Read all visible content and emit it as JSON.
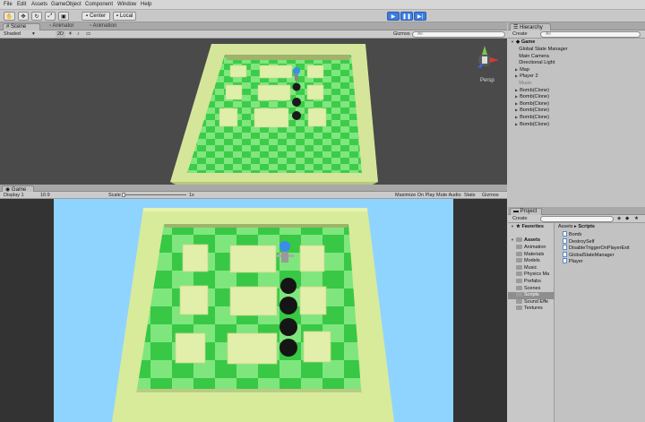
{
  "menu": [
    "File",
    "Edit",
    "Assets",
    "GameObject",
    "Component",
    "Window",
    "Help"
  ],
  "toolbar": {
    "center_label": "Center",
    "local_label": "Local"
  },
  "scene_panel": {
    "tabs": [
      "Scene",
      "Animator",
      "Animation"
    ],
    "shaded_label": "Shaded",
    "mode_2d": "2D",
    "gizmos_label": "Gizmos",
    "search_placeholder": "All",
    "persp_label": "Persp"
  },
  "game_panel": {
    "tab": "Game",
    "display_label": "Display 1",
    "aspect_label": "16:9",
    "scale_label": "Scale",
    "scale_value": "1x",
    "maximize_label": "Maximize On Play",
    "mute_label": "Mute Audio",
    "stats_label": "Stats",
    "gizmos_label": "Gizmos"
  },
  "hierarchy": {
    "tab": "Hierarchy",
    "create_label": "Create",
    "search_placeholder": "All",
    "scene_name": "Game",
    "items": [
      {
        "label": "Global State Manager",
        "expandable": false,
        "dim": false
      },
      {
        "label": "Main Camera",
        "expandable": false,
        "dim": false
      },
      {
        "label": "Directional Light",
        "expandable": false,
        "dim": false
      },
      {
        "label": "Map",
        "expandable": true,
        "dim": false
      },
      {
        "label": "Player 2",
        "expandable": true,
        "dim": false
      },
      {
        "label": "Music",
        "expandable": false,
        "dim": true
      },
      {
        "label": "Bomb(Clone)",
        "expandable": true,
        "dim": false
      },
      {
        "label": "Bomb(Clone)",
        "expandable": true,
        "dim": false
      },
      {
        "label": "Bomb(Clone)",
        "expandable": true,
        "dim": false
      },
      {
        "label": "Bomb(Clone)",
        "expandable": true,
        "dim": false
      },
      {
        "label": "Bomb(Clone)",
        "expandable": true,
        "dim": false
      },
      {
        "label": "Bomb(Clone)",
        "expandable": true,
        "dim": false
      }
    ]
  },
  "project": {
    "tab": "Project",
    "create_label": "Create",
    "favorites_label": "Favorites",
    "assets_label": "Assets",
    "folders": [
      "Animation",
      "Materials",
      "Models",
      "Music",
      "Physics Ma",
      "Prefabs",
      "Scenes",
      "Scripts",
      "Sound Effe",
      "Textures"
    ],
    "selected_folder": "Scripts",
    "breadcrumb": [
      "Assets",
      "Scripts"
    ],
    "scripts": [
      "Bomb",
      "DestroySelf",
      "DisableTriggerOnPlayerExit",
      "GlobalStateManager",
      "Player"
    ]
  },
  "colors": {
    "play_accent": "#3c7ce0",
    "board_dark": "#38cc45",
    "board_light": "#7fe87f",
    "wall": "#d8eb9a",
    "sky": "#8fd4ff"
  }
}
